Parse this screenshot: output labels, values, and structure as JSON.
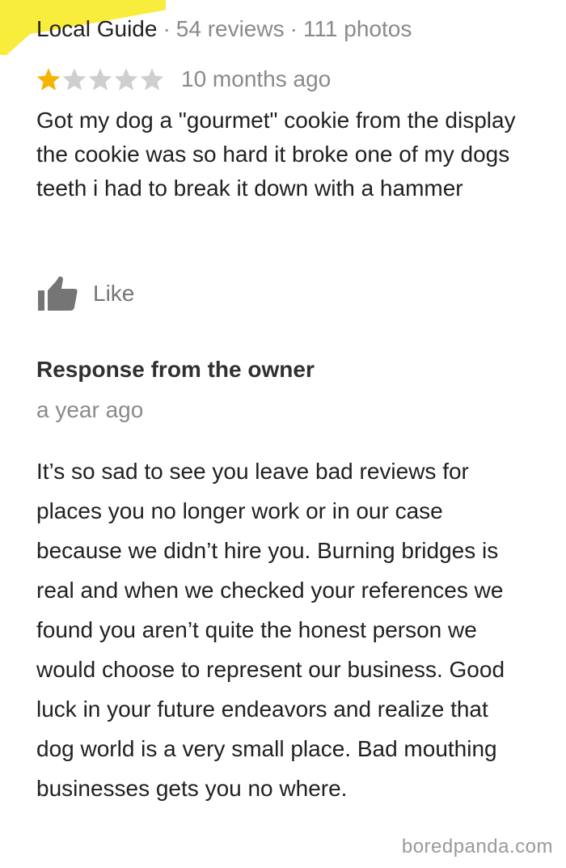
{
  "review": {
    "reviewer_badge": "Local Guide",
    "reviews_count": "54 reviews",
    "photos_count": "111 photos",
    "separator": "·",
    "rating": 1,
    "rating_max": 5,
    "time_ago": "10 months ago",
    "text": "Got my dog a \"gourmet\" cookie from the display the cookie was so hard it broke one of my dogs teeth i had to break it down with a hammer",
    "like_label": "Like",
    "like_icon": "thumbs-up-icon"
  },
  "owner_response": {
    "title": "Response from the owner",
    "time_ago": "a year ago",
    "text": "It’s so sad to see you leave bad reviews for places you no longer work or in our case because we didn’t hire you. Burning bridges is real and when we checked your references we found you aren’t quite the honest person we would choose to represent our business. Good luck in your future endeavors and realize that dog world is a very small place. Bad mouthing businesses gets you no where."
  },
  "watermark": "boredpanda.com",
  "colors": {
    "star_filled": "#f4b400",
    "star_empty": "#cfcfcf",
    "highlight": "#f8ec3c",
    "muted_text": "#8a8a8a",
    "like_icon": "#757575"
  }
}
